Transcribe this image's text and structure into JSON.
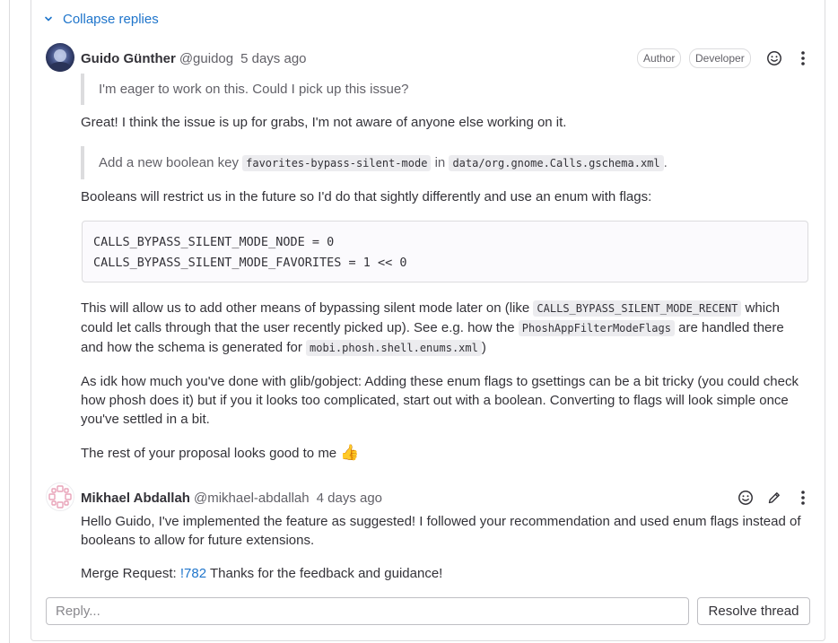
{
  "thread": {
    "collapse_label": "Collapse replies",
    "notes": [
      {
        "author_name": "Guido Günther",
        "author_handle": "@guidog",
        "time": "5 days ago",
        "badges": [
          "Author",
          "Developer"
        ],
        "quote1": "I'm eager to work on this. Could I pick up this issue?",
        "para1": "Great! I think the issue is up for grabs, I'm not aware of anyone else working on it.",
        "quote2": {
          "prefix": "Add a new boolean key ",
          "code1": "favorites-bypass-silent-mode",
          "mid": " in ",
          "code2": "data/org.gnome.Calls.gschema.xml",
          "suffix": "."
        },
        "para2": "Booleans will restrict us in the future so I'd do that sightly differently and use an enum with flags:",
        "code_lines": [
          "CALLS_BYPASS_SILENT_MODE_NODE = 0",
          "CALLS_BYPASS_SILENT_MODE_FAVORITES = 1 << 0"
        ],
        "para3": {
          "t1": "This will allow us to add other means of bypassing silent mode later on (like ",
          "c1": "CALLS_BYPASS_SILENT_MODE_RECENT",
          "t2": " which",
          "t3": "could let calls through that the user recently picked up). See e.g. how the ",
          "c2": "PhoshAppFilterModeFlags",
          "t4": " are handled there",
          "t5": "and how the schema is generated for ",
          "c3": "mobi.phosh.shell.enums.xml",
          "t6": ")"
        },
        "para4": [
          "As idk how much you've done with glib/gobject: Adding these enum flags to gsettings can be a bit tricky (you could check",
          "how phosh does it) but if you it looks too complicated, start out with a boolean. Converting to flags will look simple once",
          "you've settled in a bit."
        ],
        "para5": "The rest of your proposal looks good to me",
        "emoji": "👍"
      },
      {
        "author_name": "Mikhael Abdallah",
        "author_handle": "@mikhael-abdallah",
        "time": "4 days ago",
        "para1": [
          "Hello Guido, I've implemented the feature as suggested! I followed your recommendation and used enum flags instead of",
          "booleans to allow for future extensions."
        ],
        "para2_prefix": "Merge Request: ",
        "para2_link": "!782",
        "para2_suffix": " Thanks for the feedback and guidance!"
      }
    ],
    "reply_placeholder": "Reply...",
    "resolve_label": "Resolve thread"
  },
  "colors": {
    "link": "#1f75cb",
    "border": "#dcdcde",
    "muted": "#626168"
  },
  "icons": [
    "chevron-down-icon",
    "emoji-icon",
    "more-vertical-icon",
    "pencil-icon"
  ]
}
